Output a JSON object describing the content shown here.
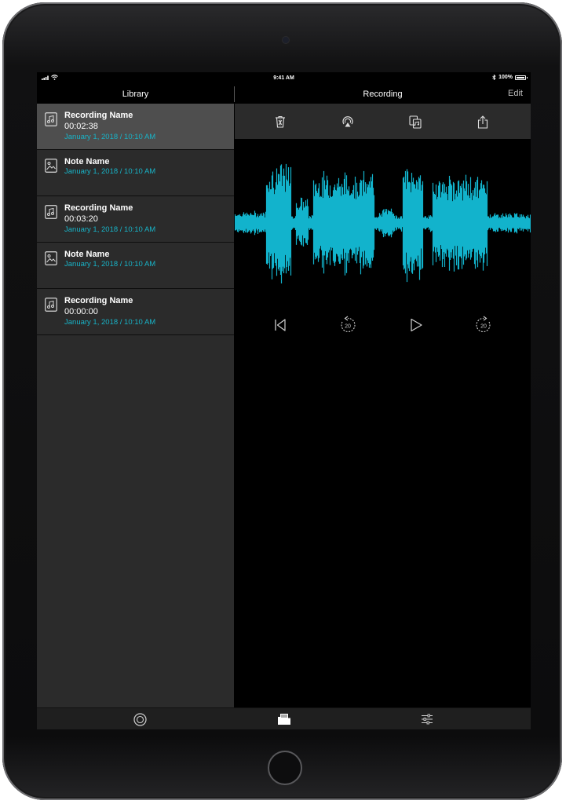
{
  "status_bar": {
    "time": "9:41 AM",
    "battery": "100%",
    "battery_level": 1.0
  },
  "library": {
    "title": "Library",
    "items": [
      {
        "type": "recording",
        "icon": "music-note-icon",
        "title": "Recording Name",
        "duration": "00:02:38",
        "date": "January 1, 2018 / 10:10 AM",
        "selected": true
      },
      {
        "type": "note",
        "icon": "image-icon",
        "title": "Note Name",
        "duration": "",
        "date": "January 1, 2018 / 10:10 AM",
        "selected": false
      },
      {
        "type": "recording",
        "icon": "music-note-icon",
        "title": "Recording Name",
        "duration": "00:03:20",
        "date": "January 1, 2018 / 10:10 AM",
        "selected": false
      },
      {
        "type": "note",
        "icon": "image-icon",
        "title": "Note Name",
        "duration": "",
        "date": "January 1, 2018 / 10:10 AM",
        "selected": false
      },
      {
        "type": "recording",
        "icon": "music-note-icon",
        "title": "Recording Name",
        "duration": "00:00:00",
        "date": "January 1, 2018 / 10:10 AM",
        "selected": false
      }
    ]
  },
  "recording": {
    "title": "Recording",
    "edit_label": "Edit",
    "toolbar": {
      "icons": [
        "trash-icon",
        "airplay-icon",
        "copy-icon",
        "share-icon"
      ]
    },
    "waveform_color": "#12b3cc",
    "player": {
      "icons": [
        "skip-to-start-icon",
        "rewind-20-icon",
        "play-icon",
        "forward-20-icon"
      ],
      "rewind_label": "20",
      "forward_label": "20"
    }
  },
  "tabbar": {
    "icons": [
      "record-tab-icon",
      "library-tab-icon",
      "settings-tab-icon"
    ]
  },
  "colors": {
    "accent": "#18b4c8",
    "panel": "#2b2b2b",
    "selected_row": "#4e4e4e"
  }
}
